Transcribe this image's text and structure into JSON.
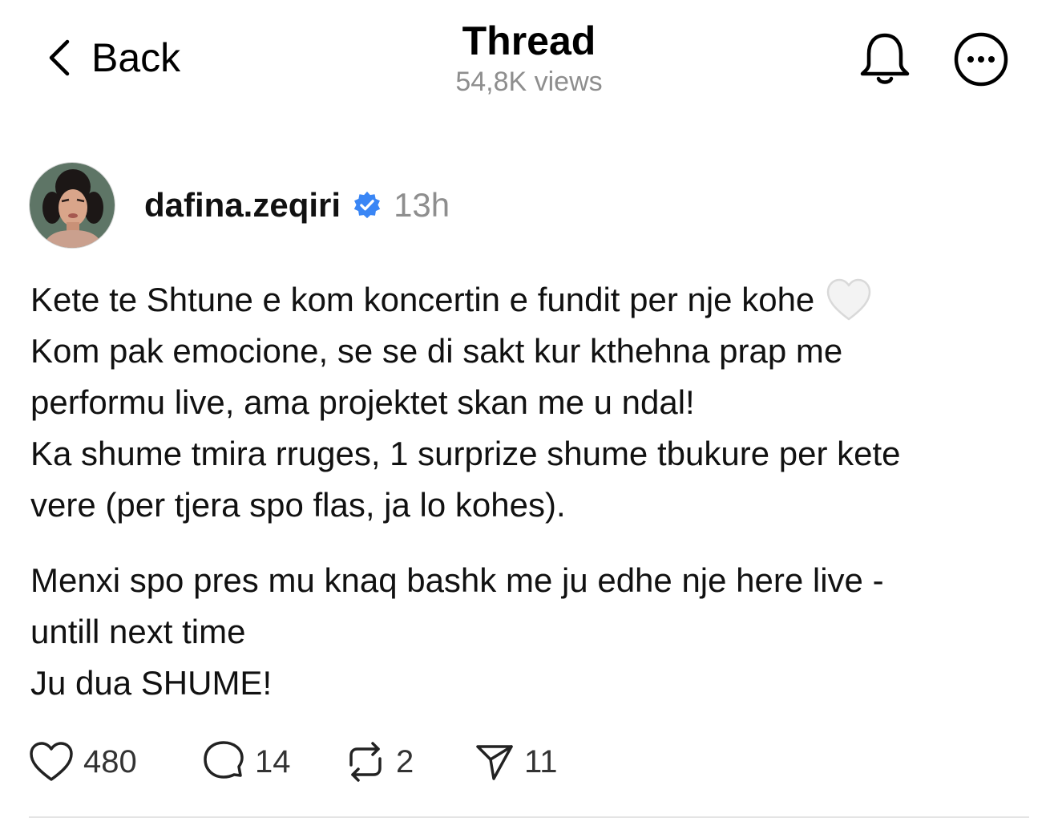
{
  "header": {
    "back_label": "Back",
    "title": "Thread",
    "views": "54,8K views",
    "icons": [
      "chevron-left-icon",
      "bell-icon",
      "more-icon"
    ]
  },
  "author": {
    "username": "dafina.zeqiri",
    "verified": true,
    "time": "13h"
  },
  "post": {
    "line1": "Kete te Shtune e kom koncertin e fundit per nje kohe",
    "line1_emoji": "white-heart-emoji",
    "line2": "Kom pak emocione, se se di sakt kur kthehna prap me",
    "line3": "performu live, ama projektet skan me u ndal!",
    "line4": "Ka shume tmira rruges, 1 surprize shume tbukure per kete",
    "line5": "vere (per tjera spo flas, ja lo kohes).",
    "line6": "Menxi spo pres mu knaq bashk me ju edhe nje here live -",
    "line7": "untill next time",
    "line8": "Ju dua SHUME!"
  },
  "actions": {
    "likes": "480",
    "replies": "14",
    "reposts": "2",
    "shares": "11"
  },
  "colors": {
    "text": "#111111",
    "muted": "#8e8e8e",
    "verified_badge": "#3a86f5",
    "divider": "#e4e4e4"
  }
}
